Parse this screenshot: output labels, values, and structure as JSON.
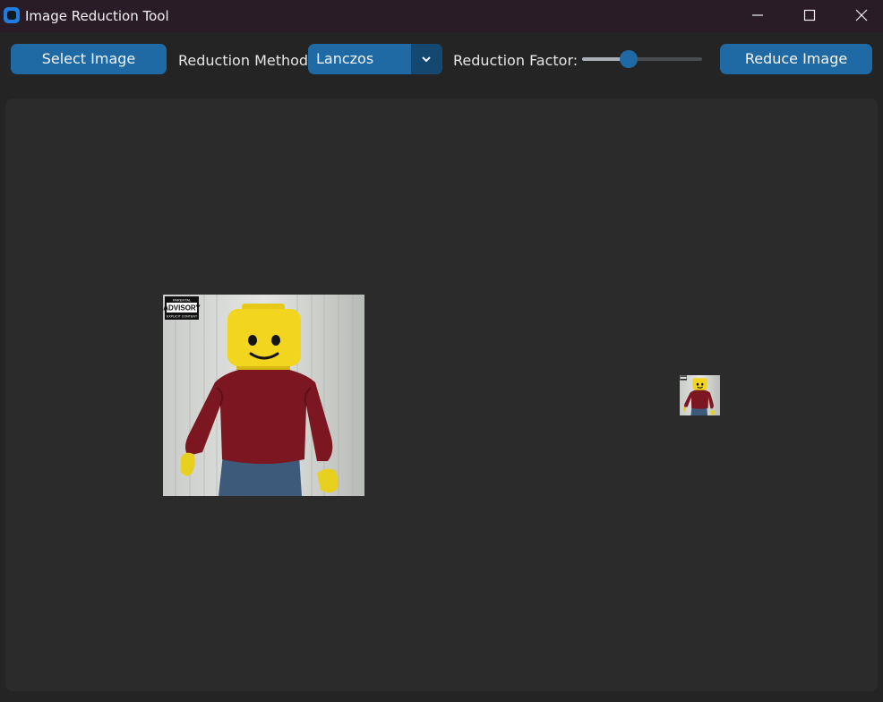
{
  "window": {
    "title": "Image Reduction Tool",
    "icon": "app-icon"
  },
  "toolbar": {
    "select_label": "Select Image",
    "method_label": "Reduction Method:",
    "method_value": "Lanczos",
    "factor_label": "Reduction Factor:",
    "factor_fraction": 0.39,
    "reduce_label": "Reduce Image"
  },
  "images": {
    "original": {
      "advisory_lines": [
        "PARENTAL",
        "ADVISORY",
        "EXPLICIT CONTENT"
      ]
    },
    "reduced": {}
  },
  "colors": {
    "accent": "#1f6aa5",
    "titlebar": "#2a1c26",
    "panel": "#2b2b2b"
  }
}
